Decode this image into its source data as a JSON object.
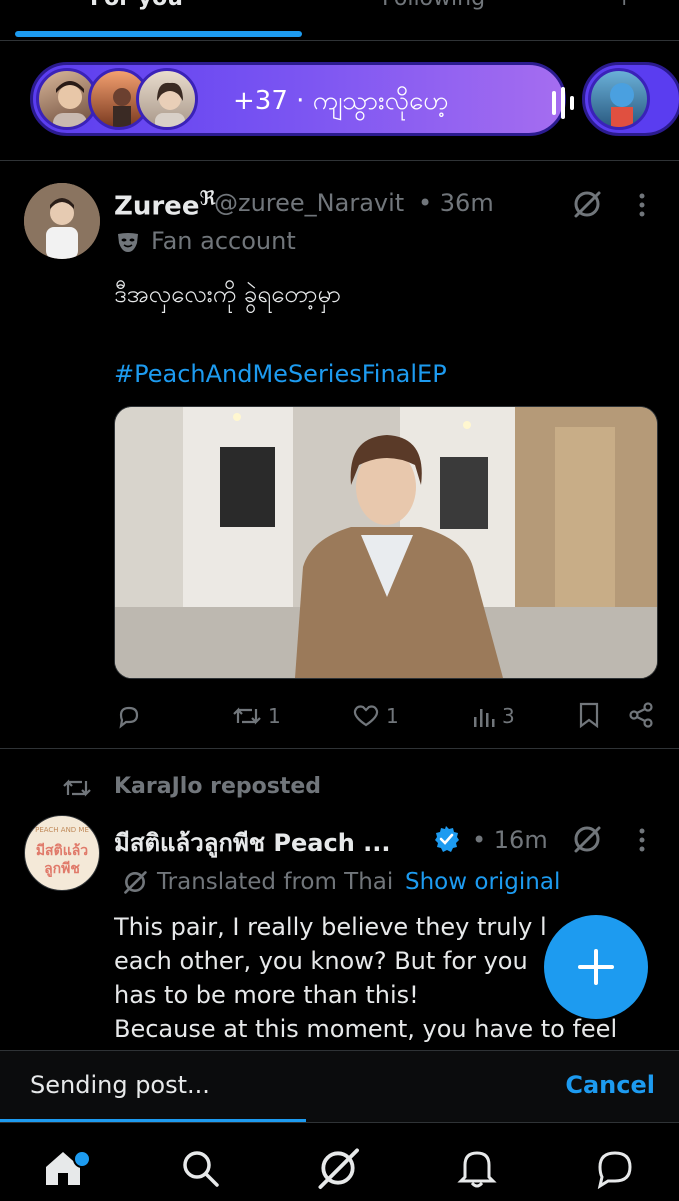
{
  "tabs": {
    "for_you": "For you",
    "following": "Following",
    "more": "+"
  },
  "space": {
    "label": "+37 · ကျသွားလိုဟေ့"
  },
  "tweet1": {
    "name": "Zuree",
    "name_badge": "ℜ",
    "handle": "@zuree_Naravit",
    "time": "• 36m",
    "fan_label": "Fan account",
    "text": "ဒီအလှလေးကို ခွဲရတော့မှာ",
    "hashtag": "#PeachAndMeSeriesFinalEP",
    "stats": {
      "replies": "",
      "retweets": "1",
      "likes": "1",
      "views": "3"
    }
  },
  "repost": {
    "label": "KaraJlo reposted"
  },
  "tweet2": {
    "name": "มีสติแล้วลูกพีช Peach ...",
    "time": "• 16m",
    "translated": "Translated from Thai",
    "show_original": "Show original",
    "avatar_top": "PEACH AND ME",
    "avatar_text1": "มีสติแล้ว",
    "avatar_text2": "ลูกพีช",
    "lines": [
      "This pair, I really believe they truly l",
      "each other, you know? But for you",
      "has to be more than this!",
      "Because at this moment, you have to feel"
    ]
  },
  "sending": {
    "label": "Sending post...",
    "cancel": "Cancel",
    "progress": 0.45
  },
  "colors": {
    "accent": "#1d9bf0",
    "bg": "#000000",
    "muted": "#71767b"
  },
  "nav": [
    "home-icon",
    "search-icon",
    "grok-icon",
    "notifications-icon",
    "messages-icon"
  ]
}
